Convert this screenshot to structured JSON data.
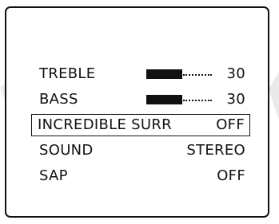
{
  "menu": {
    "items": [
      {
        "label": "TREBLE",
        "value": "30",
        "level": 0.55
      },
      {
        "label": "BASS",
        "value": "30",
        "level": 0.55
      },
      {
        "label": "INCREDIBLE SURR",
        "value": "OFF",
        "selected": true
      },
      {
        "label": "SOUND",
        "value": "STEREO"
      },
      {
        "label": "SAP",
        "value": "OFF"
      }
    ]
  },
  "colors": {
    "text": "#111111",
    "frame": "#111111",
    "background": "#ffffff",
    "watermark_shape": "#e9e9e9"
  }
}
